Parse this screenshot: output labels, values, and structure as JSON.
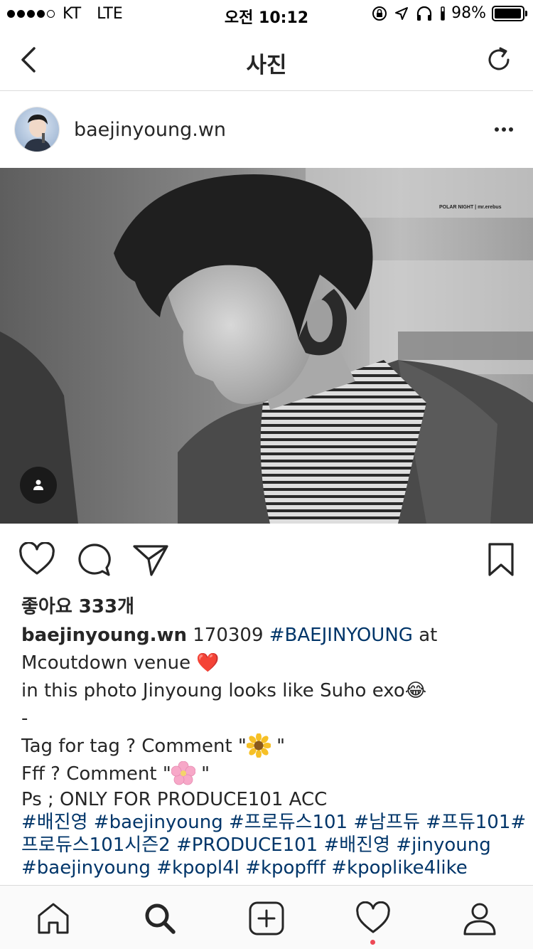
{
  "status_bar": {
    "carrier": "KT",
    "network": "LTE",
    "time": "오전 10:12",
    "battery": "98%",
    "battery_level": 0.98
  },
  "nav": {
    "title": "사진"
  },
  "post": {
    "username": "baejinyoung.wn",
    "likes": "좋아요 333개",
    "caption": {
      "username": "baejinyoung.wn",
      "l1_text": " 170309 ",
      "l1_tag": "#BAEJINYOUNG",
      "l1_after": " at",
      "l2": "Mcoutdown venue ",
      "l2_emoji": "❤️",
      "l3": "in this photo Jinyoung looks like Suho exo",
      "l3_emoji": "😂",
      "l4": "-",
      "l5": "Tag for tag ? Comment \"",
      "l5_end": " \"",
      "l6": "Fff ? Comment \"",
      "l6_end": " \"",
      "l7": "Ps ; ONLY FOR PRODUCE101 ACC",
      "hashtags_l1": "#배진영 #baejinyoung #프로듀스101 #남프듀 #프듀101#",
      "hashtags_l2a": "프로듀스101시즌2 #PRODUCE101 #배진영 #jinyoung",
      "hashtags_l3": "#baejinyoung #kpopl4l #kpopfff #kpoplike4like"
    },
    "photo_watermark": "POLAR NIGHT  |  mr.erebus"
  },
  "icons": {
    "back": "chevron-left-icon",
    "refresh": "refresh-icon",
    "more": "more-icon",
    "tag_people": "person-icon",
    "like": "heart-icon",
    "comment": "comment-icon",
    "share": "paper-plane-icon",
    "save": "bookmark-icon",
    "tabs": [
      "home-icon",
      "search-icon",
      "add-icon",
      "activity-heart-icon",
      "profile-icon"
    ]
  },
  "colors": {
    "hashtag": "#003569",
    "notification": "#ed4956",
    "heart_emoji": "#e0245e"
  }
}
